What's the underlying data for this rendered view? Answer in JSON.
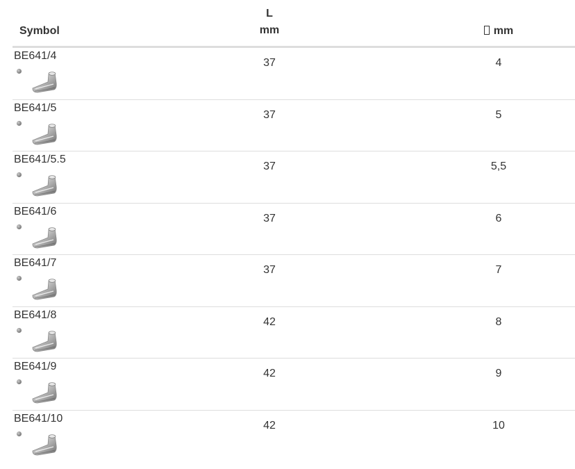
{
  "table": {
    "headers": {
      "symbol": "Symbol",
      "length_line1": "L",
      "length_line2": "mm",
      "diameter": "mm",
      "diameter_icon": "missing-glyph-box-icon"
    },
    "rows": [
      {
        "symbol": "BE641/4",
        "length": "37",
        "diameter": "4"
      },
      {
        "symbol": "BE641/5",
        "length": "37",
        "diameter": "5"
      },
      {
        "symbol": "BE641/5.5",
        "length": "37",
        "diameter": "5,5"
      },
      {
        "symbol": "BE641/6",
        "length": "37",
        "diameter": "6"
      },
      {
        "symbol": "BE641/7",
        "length": "37",
        "diameter": "7"
      },
      {
        "symbol": "BE641/8",
        "length": "42",
        "diameter": "8"
      },
      {
        "symbol": "BE641/9",
        "length": "42",
        "diameter": "9"
      },
      {
        "symbol": "BE641/10",
        "length": "42",
        "diameter": "10"
      }
    ]
  },
  "colors": {
    "text": "#333333",
    "header_rule": "#dddddd",
    "row_rule": "#dddddd"
  }
}
